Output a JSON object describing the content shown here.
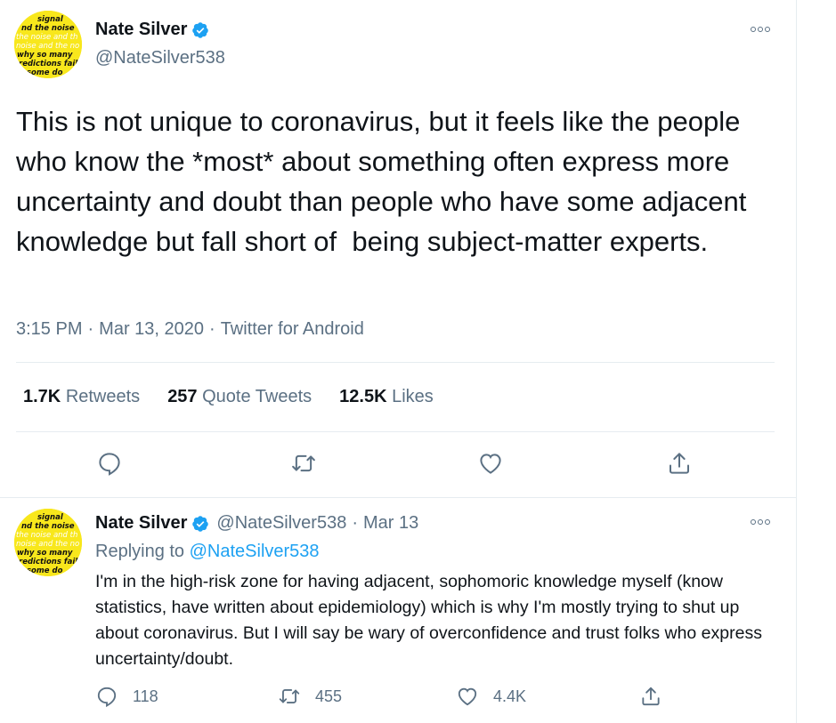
{
  "colors": {
    "accent": "#1da1f2",
    "secondary_text": "#5b7083",
    "border": "#e6ecf0",
    "avatar_bg": "#f8e71c"
  },
  "avatar": {
    "lines": [
      "signal",
      "nd the noise",
      "the noise and th",
      "noise and the no",
      "why so many",
      "redictions fail",
      "some do"
    ]
  },
  "main_tweet": {
    "author_name": "Nate Silver",
    "handle": "@NateSilver538",
    "text": "This is not unique to coronavirus, but it feels like the people who know the *most* about something often express more uncertainty and doubt than people who have some adjacent knowledge but fall short of  being subject-matter experts.",
    "time": "3:15 PM",
    "date": "Mar 13, 2020",
    "source": "Twitter for Android",
    "separator": "·",
    "stats": [
      {
        "num": "1.7K",
        "label": "Retweets"
      },
      {
        "num": "257",
        "label": "Quote Tweets"
      },
      {
        "num": "12.5K",
        "label": "Likes"
      }
    ],
    "actions": [
      "reply-icon",
      "retweet-icon",
      "like-icon",
      "share-icon"
    ]
  },
  "reply_tweet": {
    "author_name": "Nate Silver",
    "handle": "@NateSilver538",
    "separator": "·",
    "date": "Mar 13",
    "replying_prefix": "Replying to",
    "replying_to": "@NateSilver538",
    "text": "I'm in the high-risk zone for having adjacent, sophomoric knowledge myself (know statistics, have written about epidemiology) which is why I'm mostly trying to shut up about coronavirus. But I will say be wary of overconfidence and trust folks who express uncertainty/doubt.",
    "counts": {
      "replies": "118",
      "retweets": "455",
      "likes": "4.4K"
    }
  }
}
